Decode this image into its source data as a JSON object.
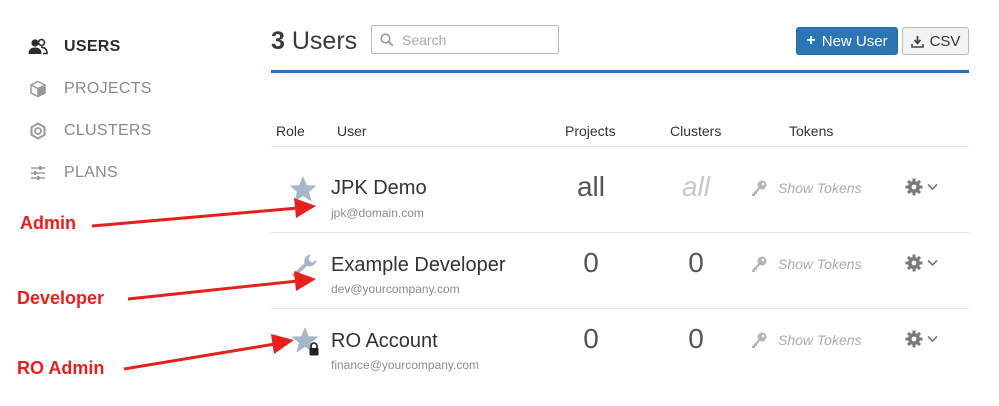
{
  "sidebar": {
    "items": [
      {
        "label": "USERS",
        "icon": "users-icon",
        "active": true
      },
      {
        "label": "PROJECTS",
        "icon": "cube-icon",
        "active": false
      },
      {
        "label": "CLUSTERS",
        "icon": "hexagon-icon",
        "active": false
      },
      {
        "label": "PLANS",
        "icon": "sliders-icon",
        "active": false
      }
    ]
  },
  "header": {
    "count": "3",
    "title_suffix": "Users",
    "search_placeholder": "Search",
    "new_user_label": "New User",
    "csv_label": "CSV",
    "accent": "#2d76b5"
  },
  "table": {
    "columns": {
      "role": "Role",
      "user": "User",
      "projects": "Projects",
      "clusters": "Clusters",
      "tokens": "Tokens"
    },
    "rows": [
      {
        "role_icon": "star-icon",
        "name": "JPK Demo",
        "email": "jpk@domain.com",
        "projects": "all",
        "clusters": "all",
        "tokens": "Show Tokens"
      },
      {
        "role_icon": "wrench-icon",
        "name": "Example Developer",
        "email": "dev@yourcompany.com",
        "projects": "0",
        "clusters": "0",
        "tokens": "Show Tokens"
      },
      {
        "role_icon": "star-lock-icon",
        "name": "RO Account",
        "email": "finance@yourcompany.com",
        "projects": "0",
        "clusters": "0",
        "tokens": "Show Tokens"
      }
    ]
  },
  "annotations": [
    {
      "label": "Admin",
      "color": "#e4211c"
    },
    {
      "label": "Developer",
      "color": "#e4211c"
    },
    {
      "label": "RO Admin",
      "color": "#e4211c"
    }
  ]
}
